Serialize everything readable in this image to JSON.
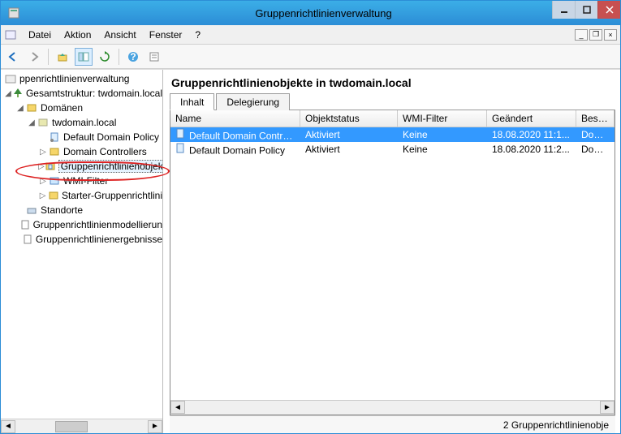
{
  "window": {
    "title": "Gruppenrichtlinienverwaltung"
  },
  "menus": {
    "file": "Datei",
    "action": "Aktion",
    "view": "Ansicht",
    "window": "Fenster",
    "help": "?"
  },
  "tree": {
    "root": "ppenrichtlinienverwaltung",
    "forest": "Gesamtstruktur: twdomain.local",
    "domains": "Domänen",
    "domain": "twdomain.local",
    "ddp": "Default Domain Policy",
    "dc": "Domain Controllers",
    "gpo": "Gruppenrichtlinienobjekte",
    "wmi": "WMI-Filter",
    "starter": "Starter-Gruppenrichtlini",
    "sites": "Standorte",
    "modeling": "Gruppenrichtlinienmodellierun",
    "results": "Gruppenrichtlinienergebnisse"
  },
  "right": {
    "heading": "Gruppenrichtlinienobjekte in twdomain.local",
    "tabs": {
      "content": "Inhalt",
      "delegation": "Delegierung"
    },
    "columns": {
      "name": "Name",
      "status": "Objektstatus",
      "wmi": "WMI-Filter",
      "modified": "Geändert",
      "owner": "Besitzer"
    },
    "rows": [
      {
        "name": "Default Domain Controll...",
        "status": "Aktiviert",
        "wmi": "Keine",
        "modified": "18.08.2020 11:1...",
        "owner": "Domain A"
      },
      {
        "name": "Default Domain Policy",
        "status": "Aktiviert",
        "wmi": "Keine",
        "modified": "18.08.2020 11:2...",
        "owner": "Domain A"
      }
    ]
  },
  "status": "2 Gruppenrichtlinienobje"
}
